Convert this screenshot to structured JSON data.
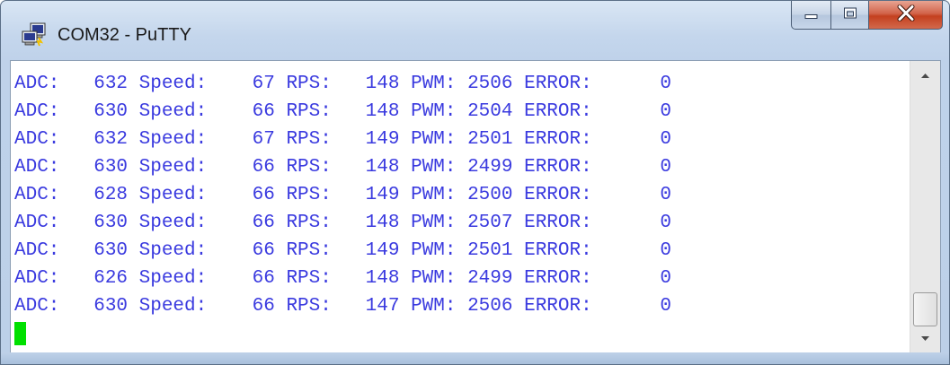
{
  "window": {
    "title": "COM32 - PuTTY",
    "app_icon": "putty-icon",
    "buttons": {
      "minimize_icon": "minimize-icon",
      "maximize_icon": "maximize-icon",
      "close_icon": "close-icon"
    }
  },
  "terminal": {
    "text_color": "#3a3adf",
    "cursor_color": "#00e000",
    "lines": [
      "ADC:   632 Speed:    67 RPS:   148 PWM: 2506 ERROR:      0",
      "ADC:   630 Speed:    66 RPS:   148 PWM: 2504 ERROR:      0",
      "ADC:   632 Speed:    67 RPS:   149 PWM: 2501 ERROR:      0",
      "ADC:   630 Speed:    66 RPS:   148 PWM: 2499 ERROR:      0",
      "ADC:   628 Speed:    66 RPS:   149 PWM: 2500 ERROR:      0",
      "ADC:   630 Speed:    66 RPS:   148 PWM: 2507 ERROR:      0",
      "ADC:   630 Speed:    66 RPS:   149 PWM: 2501 ERROR:      0",
      "ADC:   626 Speed:    66 RPS:   148 PWM: 2499 ERROR:      0",
      "ADC:   630 Speed:    66 RPS:   147 PWM: 2506 ERROR:      0"
    ]
  },
  "scrollbar": {
    "up_icon": "scroll-up-arrow-icon",
    "down_icon": "scroll-down-arrow-icon"
  }
}
